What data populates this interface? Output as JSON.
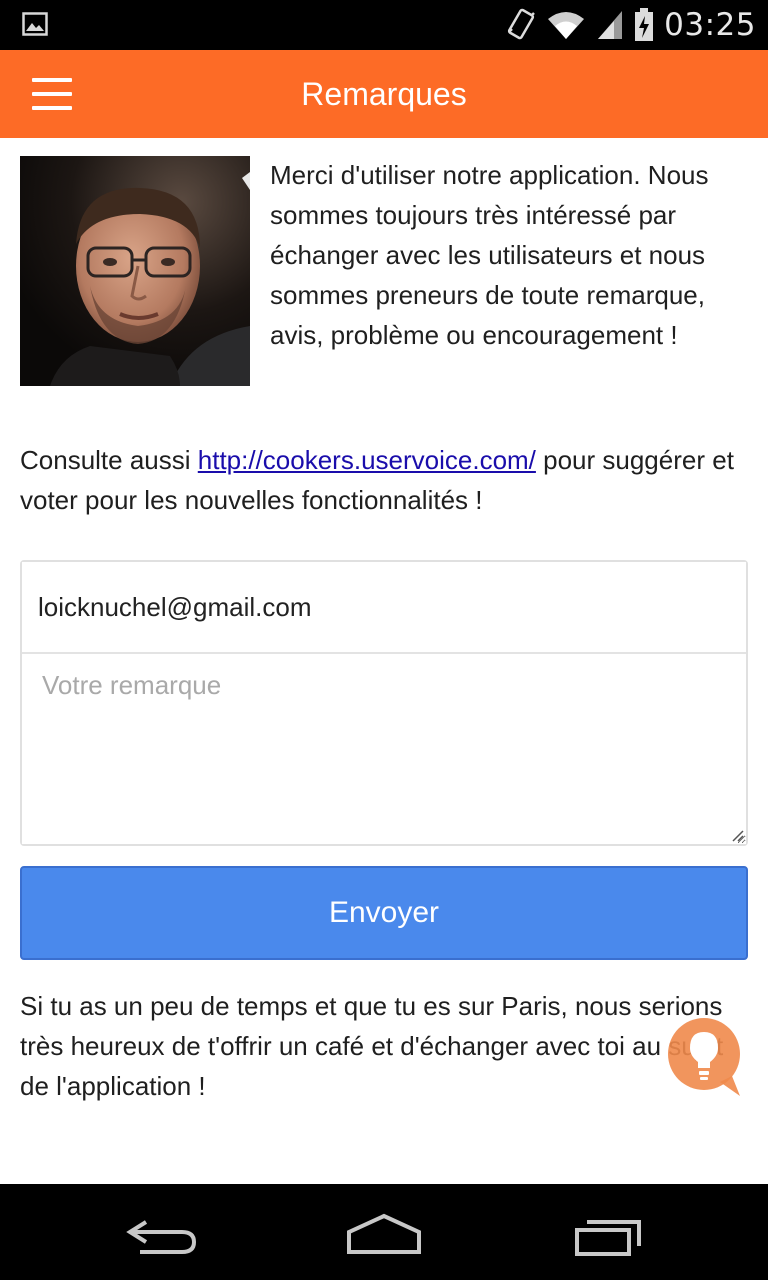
{
  "status_bar": {
    "time": "03:25",
    "icons": [
      "image-icon",
      "vibrate-icon",
      "wifi-icon",
      "cell-signal-icon",
      "battery-charging-icon"
    ]
  },
  "app_bar": {
    "title": "Remarques",
    "menu_icon": "hamburger-menu-icon",
    "color": "#fd6b26"
  },
  "intro": {
    "text": "Merci d'utiliser notre application. Nous sommes toujours très intéressé par échanger avec les utilisateurs et nous sommes preneurs de toute remarque, avis, problème ou encouragement !"
  },
  "consult": {
    "prefix": "Consulte aussi ",
    "link": "http://cookers.uservoice.com/",
    "suffix": " pour suggérer et voter pour les nouvelles fonctionnalités !"
  },
  "form": {
    "email_value": "loicknuchel@gmail.com",
    "remark_placeholder": "Votre remarque",
    "send_label": "Envoyer",
    "button_color": "#4a89ec"
  },
  "footer_text": "Si tu as un peu de temps et que tu es sur Paris, nous serions très heureux de t'offrir un café et d'échanger avec toi au sujet de l'application !",
  "floating_button": {
    "icon": "lightbulb-icon",
    "color": "#f08a4b"
  },
  "nav_bar": {
    "buttons": [
      "back-icon",
      "home-icon",
      "recent-apps-icon"
    ]
  }
}
